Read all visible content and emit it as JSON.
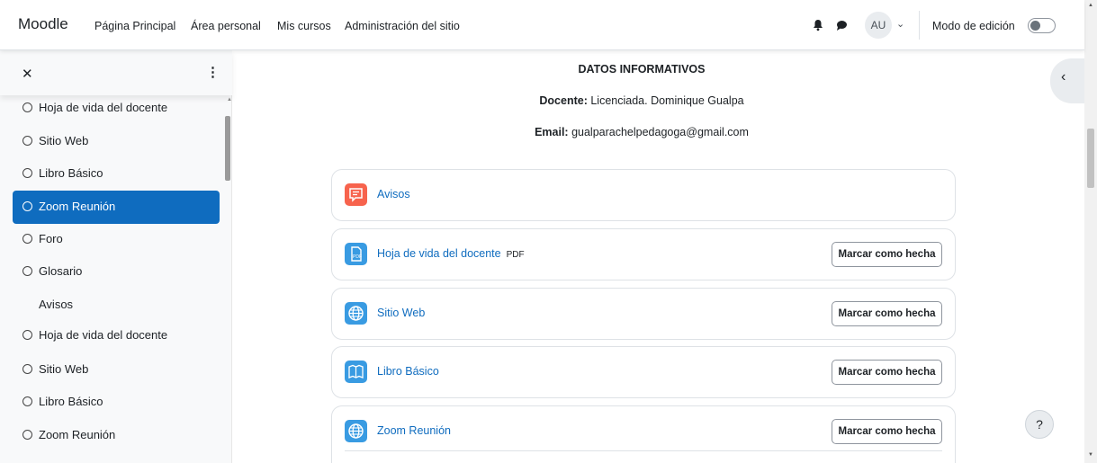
{
  "navbar": {
    "brand": "Moodle",
    "links": [
      "Página Principal",
      "Área personal",
      "Mis cursos",
      "Administración del sitio"
    ],
    "avatar_initials": "AU",
    "edit_mode_label": "Modo de edición",
    "edit_mode_on": false
  },
  "drawer": {
    "items": [
      {
        "label": "Hoja de vida del docente",
        "active": false,
        "circle": true
      },
      {
        "label": "Sitio Web",
        "active": false,
        "circle": true
      },
      {
        "label": "Libro Básico",
        "active": false,
        "circle": true
      },
      {
        "label": "Zoom Reunión",
        "active": true,
        "circle": true
      },
      {
        "label": "Foro",
        "active": false,
        "circle": true
      },
      {
        "label": "Glosario",
        "active": false,
        "circle": true
      },
      {
        "label": "Avisos",
        "active": false,
        "circle": false
      },
      {
        "label": "Hoja de vida del docente",
        "active": false,
        "circle": true
      },
      {
        "label": "Sitio Web",
        "active": false,
        "circle": true
      },
      {
        "label": "Libro Básico",
        "active": false,
        "circle": true
      },
      {
        "label": "Zoom Reunión",
        "active": false,
        "circle": true
      }
    ]
  },
  "main": {
    "title": "DATOS INFORMATIVOS",
    "docente_label": "Docente:",
    "docente_value": "Licenciada. Dominique Gualpa",
    "email_label": "Email:",
    "email_value": "gualparachelpedagoga@gmail.com",
    "activities": [
      {
        "name": "Avisos",
        "icon": "forum-icon",
        "badge": "",
        "button": ""
      },
      {
        "name": "Hoja de vida del docente",
        "icon": "pdf-file-icon",
        "badge": "PDF",
        "button": "Marcar como hecha"
      },
      {
        "name": "Sitio Web",
        "icon": "globe-icon",
        "badge": "",
        "button": "Marcar como hecha"
      },
      {
        "name": "Libro Básico",
        "icon": "book-icon",
        "badge": "",
        "button": "Marcar como hecha"
      },
      {
        "name": "Zoom Reunión",
        "icon": "globe-icon",
        "badge": "",
        "button": "Marcar como hecha"
      }
    ]
  },
  "help_label": "?",
  "colors": {
    "primary": "#0f6cbf",
    "forum": "#f7634d",
    "resource": "#399be2"
  }
}
